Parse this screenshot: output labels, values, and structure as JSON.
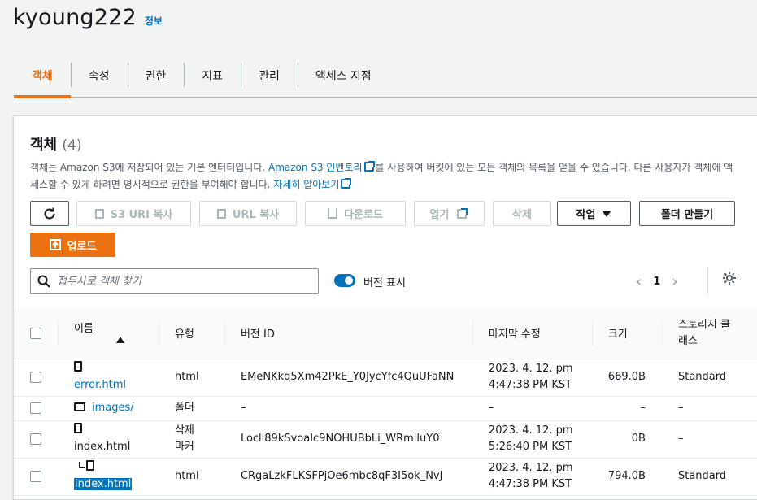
{
  "header": {
    "bucket_name": "kyoung222",
    "info_link": "정보"
  },
  "tabs": [
    {
      "label": "객체",
      "active": true
    },
    {
      "label": "속성"
    },
    {
      "label": "권한"
    },
    {
      "label": "지표"
    },
    {
      "label": "관리"
    },
    {
      "label": "액세스 지점"
    }
  ],
  "objects_panel": {
    "title": "객체",
    "count": "(4)",
    "description_part1": "객체는 Amazon S3에 저장되어 있는 기본 엔터티입니다. ",
    "inventory_link": "Amazon S3 인벤토리",
    "description_part2": "를 사용하여 버킷에 있는 모든 객체의 목록을 얻을 수 있습니다. 다른 사용자가 객체에 액세스할 수 있게 하려면 명시적으로 권한을 부여해야 합니다. ",
    "learn_more_link": "자세히 알아보기"
  },
  "toolbar": {
    "copy_s3_uri": "S3 URI 복사",
    "copy_url": "URL 복사",
    "download": "다운로드",
    "open": "열기",
    "delete": "삭제",
    "actions": "작업",
    "create_folder": "폴더 만들기",
    "upload": "업로드"
  },
  "search": {
    "placeholder": "접두사로 객체 찾기",
    "value": ""
  },
  "show_versions": {
    "label": "버전 표시",
    "enabled": true
  },
  "pagination": {
    "current_page": "1"
  },
  "table": {
    "columns": [
      "이름",
      "유형",
      "버전 ID",
      "마지막 수정",
      "크기",
      "스토리지 클래스"
    ],
    "rows": [
      {
        "name": "error.html",
        "type": "html",
        "version_id": "EMeNKkq5Xm42PkE_Y0JycYfc4QuUFaNN",
        "modified": "2023. 4. 12. pm 4:47:38 PM KST",
        "size": "669.0B",
        "storage": "Standard"
      },
      {
        "name": "images/",
        "type": "폴더",
        "version_id": "–",
        "modified": "–",
        "size": "–",
        "storage": "–"
      },
      {
        "name": "index.html",
        "type": "삭제 마커",
        "version_id": "Locli89kSvoaIc9NOHUBbLi_WRmlluY0",
        "modified": "2023. 4. 12. pm 5:26:40 PM KST",
        "size": "0B",
        "storage": "–"
      },
      {
        "name": "index.html",
        "type": "html",
        "version_id": "CRgaLzkFLKSFPjOe6mbc8qF3I5ok_NvJ",
        "modified": "2023. 4. 12. pm 4:47:38 PM KST",
        "size": "794.0B",
        "storage": "Standard"
      }
    ]
  },
  "colors": {
    "accent": "#ec7211",
    "link": "#0073bb",
    "text": "#16191f"
  }
}
